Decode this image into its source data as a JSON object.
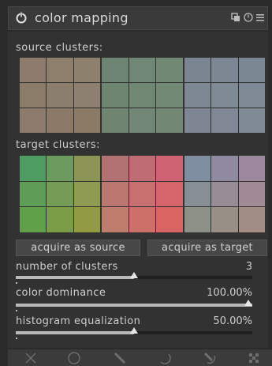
{
  "header": {
    "title": "color mapping",
    "icons": [
      "power-icon",
      "presets-icon",
      "reset-icon",
      "menu-icon"
    ]
  },
  "source": {
    "label": "source clusters:",
    "palettes": [
      [
        "#8d7c6b",
        "#8d7f6c",
        "#8d806d",
        "#8b7c6a",
        "#8c7e6c",
        "#8e806e",
        "#8c7b6a",
        "#8b7a68",
        "#8a7a66"
      ],
      [
        "#6d8472",
        "#6f8774",
        "#718875",
        "#6e8571",
        "#708774",
        "#728976",
        "#6f8572",
        "#718674",
        "#728875"
      ],
      [
        "#7b8592",
        "#7d8793",
        "#7c8794",
        "#7e8893",
        "#808a95",
        "#7f8996",
        "#7d8692",
        "#7f8894",
        "#808a95"
      ]
    ]
  },
  "target": {
    "label": "target clusters:",
    "palettes": [
      [
        "#4f9c62",
        "#6d9b5d",
        "#8c9556",
        "#5d9d57",
        "#749c57",
        "#8f9a52",
        "#60a048",
        "#7a9d45",
        "#939a44"
      ],
      [
        "#b27272",
        "#c06c74",
        "#cf6272",
        "#ba7870",
        "#c86f70",
        "#d5646b",
        "#c07c6c",
        "#cd706a",
        "#d96563"
      ],
      [
        "#7f8ea0",
        "#8f8aa0",
        "#9d889e",
        "#878f96",
        "#958c96",
        "#a08b95",
        "#8c9287",
        "#988f87",
        "#a28d86"
      ]
    ]
  },
  "buttons": {
    "acquire_source": "acquire as source",
    "acquire_target": "acquire as target"
  },
  "sliders": [
    {
      "label": "number of clusters",
      "value": "3",
      "fraction": 0.5
    },
    {
      "label": "color dominance",
      "value": "100.00%",
      "fraction": 1.0
    },
    {
      "label": "histogram equalization",
      "value": "50.00%",
      "fraction": 0.5
    }
  ],
  "footer": {
    "icons": [
      "close-icon",
      "circle-mask-icon",
      "drawn-mask-icon",
      "parametric-mask-icon",
      "combined-mask-icon",
      "raster-mask-icon"
    ]
  }
}
